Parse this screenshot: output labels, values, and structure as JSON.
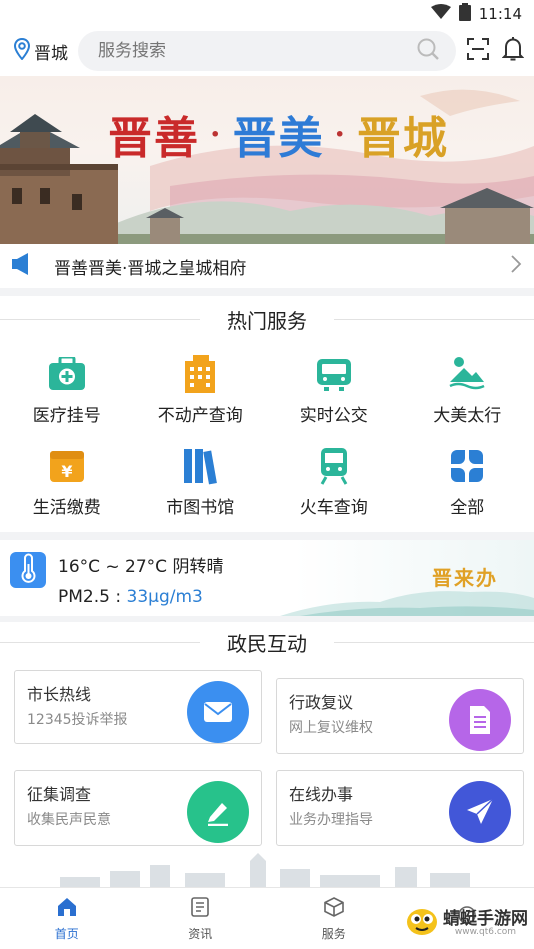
{
  "status_bar": {
    "time": "11:14"
  },
  "header": {
    "location": "晋城",
    "search_placeholder": "服务搜索"
  },
  "banner": {
    "title_1": "晋善",
    "dot": "·",
    "title_2": "晋美",
    "title_3": "晋城"
  },
  "news": {
    "text": "晋善晋美·晋城之皇城相府"
  },
  "hot_services": {
    "title": "热门服务",
    "items": [
      {
        "label": "医疗挂号",
        "icon": "medical-kit-icon",
        "color": "#2bb59a"
      },
      {
        "label": "不动产查询",
        "icon": "building-icon",
        "color": "#f2a31c"
      },
      {
        "label": "实时公交",
        "icon": "bus-icon",
        "color": "#2bb59a"
      },
      {
        "label": "大美太行",
        "icon": "mountain-icon",
        "color": "#2bb59a"
      },
      {
        "label": "生活缴费",
        "icon": "payment-icon",
        "color": "#f2a31c"
      },
      {
        "label": "市图书馆",
        "icon": "books-icon",
        "color": "#2b7fd4"
      },
      {
        "label": "火车查询",
        "icon": "train-icon",
        "color": "#2bb59a"
      },
      {
        "label": "全部",
        "icon": "grid-icon",
        "color": "#2b7fd4"
      }
    ]
  },
  "weather": {
    "temp": "16°C ~ 27°C 阴转晴",
    "pm_label": "PM2.5 : ",
    "pm_value": "33μg/m3",
    "slogan": "晋来办"
  },
  "interaction": {
    "title": "政民互动",
    "cards": [
      {
        "title": "市长热线",
        "subtitle": "12345投诉举报",
        "icon": "mail-icon",
        "color": "#3b8ff0"
      },
      {
        "title": "行政复议",
        "subtitle": "网上复议维权",
        "icon": "document-icon",
        "color": "#b666e8"
      },
      {
        "title": "征集调查",
        "subtitle": "收集民声民意",
        "icon": "edit-icon",
        "color": "#27c28b"
      },
      {
        "title": "在线办事",
        "subtitle": "业务办理指导",
        "icon": "send-icon",
        "color": "#4257d8"
      }
    ]
  },
  "bottom_nav": [
    {
      "label": "首页",
      "icon": "home-icon",
      "active": true
    },
    {
      "label": "资讯",
      "icon": "news-icon",
      "active": false
    },
    {
      "label": "服务",
      "icon": "cube-icon",
      "active": false
    },
    {
      "label": "",
      "icon": "profile-icon",
      "active": false
    }
  ],
  "watermark": {
    "name": "蜻蜓手游网",
    "url": "www.qt6.com"
  }
}
